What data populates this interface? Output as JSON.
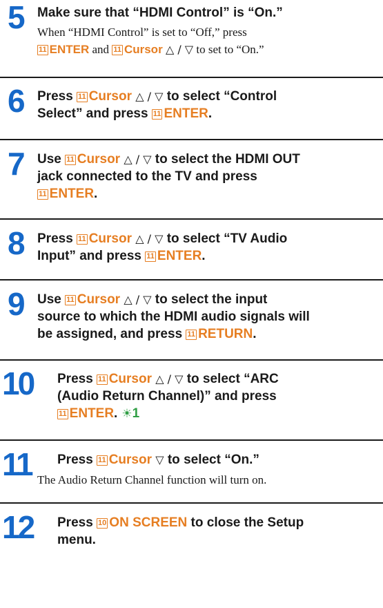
{
  "steps": [
    {
      "number": "5",
      "title": "Make sure that “HDMI Control” is “On.”",
      "body1": "When “HDMI Control” is set to “Off,” press",
      "body2_key1_num": "11",
      "body2_key1_label": "ENTER",
      "body2_and": " and ",
      "body2_key2_num": "11",
      "body2_key2_label": "Cursor",
      "body2_tail": " to set to “On.”"
    },
    {
      "number": "6",
      "l1_pre": "Press ",
      "key1_num": "11",
      "key1_label": "Cursor",
      "l1_post": " to select “Control",
      "l2_pre": "Select” and press ",
      "key2_num": "11",
      "key2_label": "ENTER",
      "l2_post": "."
    },
    {
      "number": "7",
      "l1_pre": "Use ",
      "key1_num": "11",
      "key1_label": "Cursor",
      "l1_post": " to select the HDMI OUT",
      "l2": "jack connected to the TV and press",
      "key2_num": "11",
      "key2_label": "ENTER",
      "l3_post": "."
    },
    {
      "number": "8",
      "l1_pre": "Press ",
      "key1_num": "11",
      "key1_label": "Cursor",
      "l1_post": " to select “TV Audio",
      "l2_pre": "Input” and press ",
      "key2_num": "11",
      "key2_label": "ENTER",
      "l2_post": "."
    },
    {
      "number": "9",
      "l1_pre": "Use ",
      "key1_num": "11",
      "key1_label": "Cursor",
      "l1_post": " to select the input",
      "l2": "source to which the HDMI audio signals will",
      "l3_pre": "be assigned, and press ",
      "key2_num": "11",
      "key2_label": "RETURN",
      "l3_post": "."
    },
    {
      "number": "10",
      "l1_pre": "Press ",
      "key1_num": "11",
      "key1_label": "Cursor",
      "l1_post": " to select “ARC",
      "l2": "(Audio Return Channel)” and press",
      "key2_num": "11",
      "key2_label": "ENTER",
      "l3_post": ".",
      "hint_num": "1"
    },
    {
      "number": "11",
      "l1_pre": "Press ",
      "key1_num": "11",
      "key1_label": "Cursor",
      "l1_post": " to select “On.”",
      "body": "The Audio Return Channel function will turn on."
    },
    {
      "number": "12",
      "l1_pre": "Press ",
      "key1_num": "10",
      "key1_label": "ON SCREEN",
      "l1_post": " to close the Setup",
      "l2": "menu."
    }
  ],
  "symbols": {
    "up_down": "△ / ▽",
    "down": "▽",
    "hint_icon": "☀"
  },
  "colors": {
    "step_number": "#1668c8",
    "key_accent": "#e67e22",
    "hint": "#2f9e44",
    "text": "#1a1a1a"
  }
}
